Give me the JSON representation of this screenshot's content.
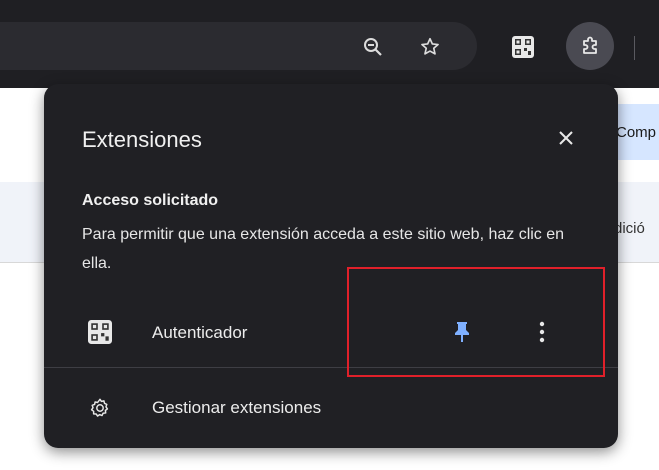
{
  "toolbar": {
    "icons": [
      "zoom-out-icon",
      "star-icon",
      "qr-code-icon",
      "puzzle-icon"
    ]
  },
  "page": {
    "right_button_text": "Comp",
    "right_band_text": "dició"
  },
  "popup": {
    "title": "Extensiones",
    "section_heading": "Acceso solicitado",
    "section_desc": "Para permitir que una extensión acceda a este sitio web, haz clic en ella.",
    "extension": {
      "name": "Autenticador",
      "icon": "qr-code-icon",
      "pinned": true
    },
    "manage_label": "Gestionar extensiones"
  },
  "colors": {
    "popup_bg": "#202024",
    "pin_accent": "#7fb0ff",
    "highlight": "#e0202a"
  }
}
